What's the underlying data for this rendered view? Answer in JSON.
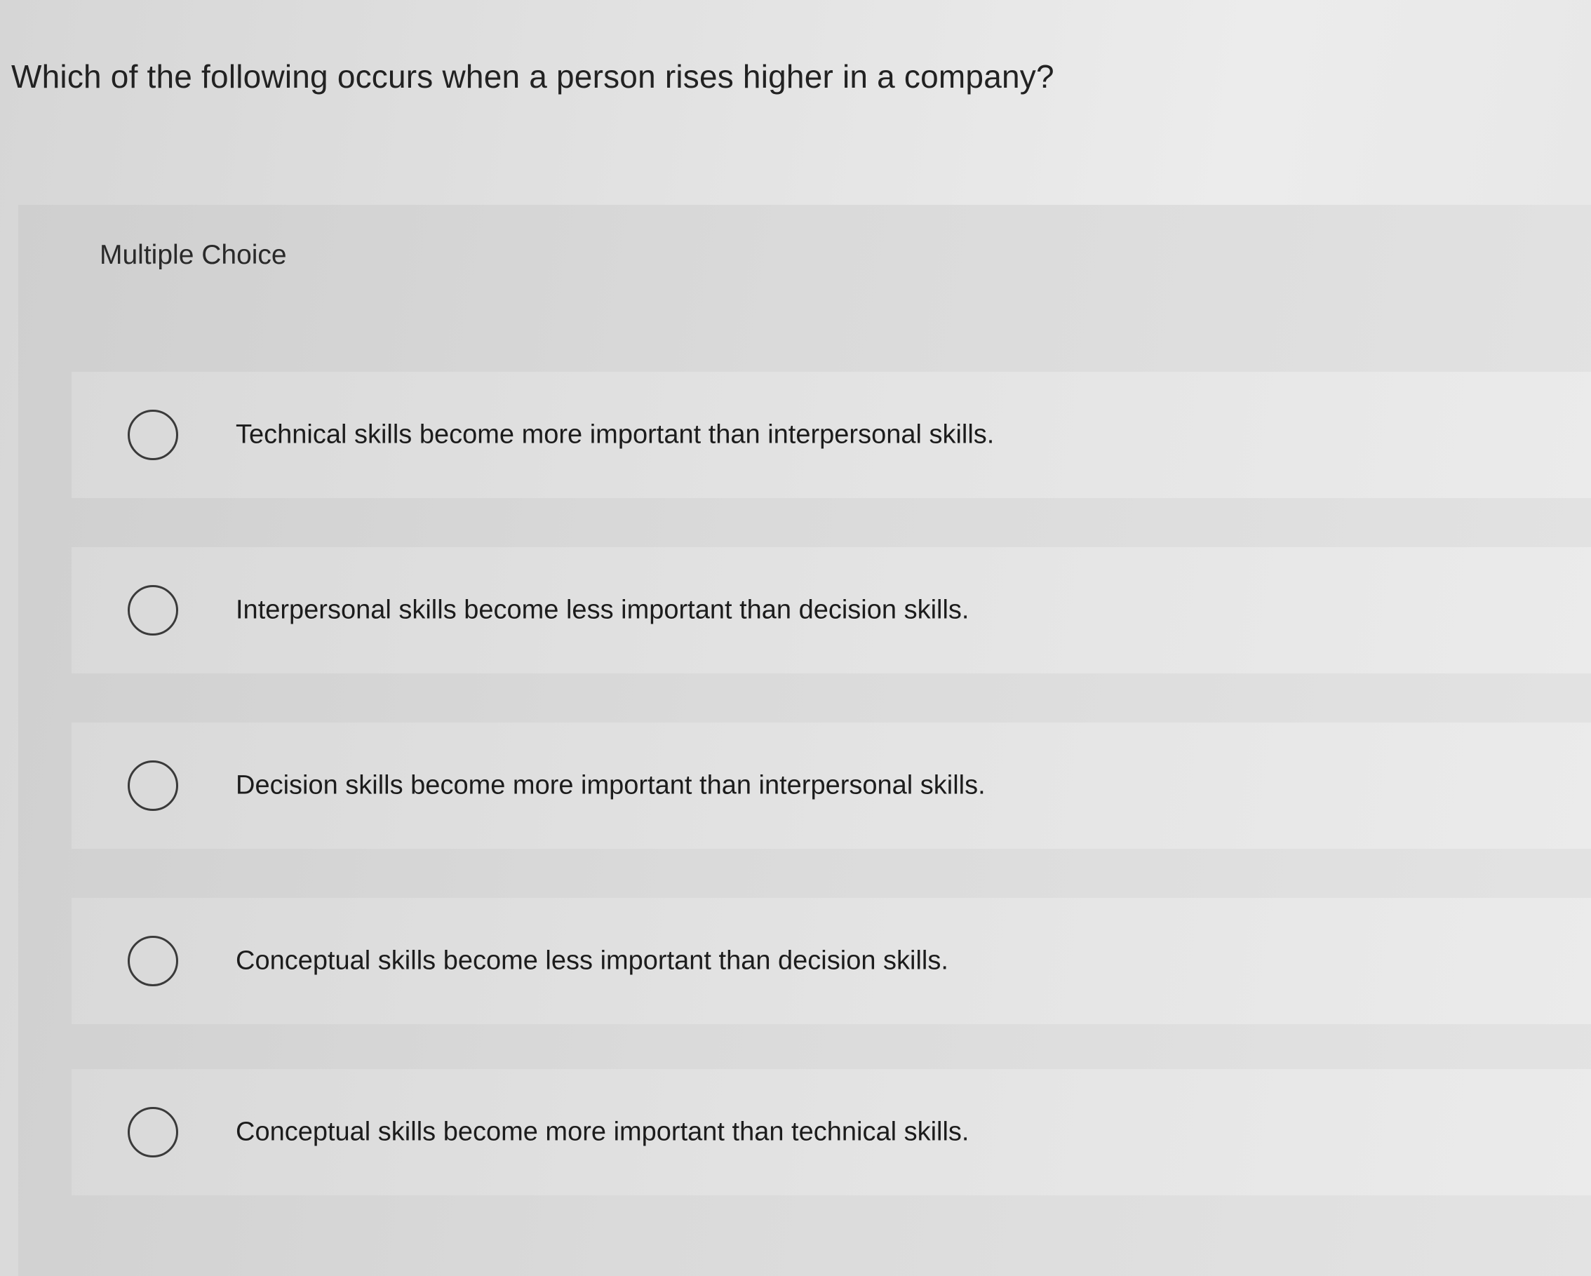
{
  "question": {
    "text": "Which of the following occurs when a person rises higher in a company?"
  },
  "multiple_choice": {
    "label": "Multiple Choice",
    "options": [
      {
        "label": "Technical skills become more important than interpersonal skills.",
        "selected": false
      },
      {
        "label": "Interpersonal skills become less important than decision skills.",
        "selected": false
      },
      {
        "label": "Decision skills become more important than interpersonal skills.",
        "selected": false
      },
      {
        "label": "Conceptual skills become less important than decision skills.",
        "selected": false
      },
      {
        "label": "Conceptual skills become more important than technical skills.",
        "selected": false
      }
    ]
  }
}
